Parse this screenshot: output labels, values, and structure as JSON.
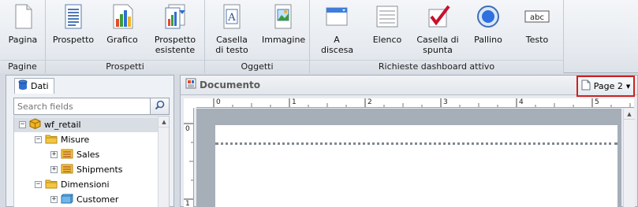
{
  "ribbon": {
    "groups": [
      {
        "label": "Pagine",
        "buttons": [
          {
            "label": "Pagina",
            "icon": "blank-page-icon"
          }
        ]
      },
      {
        "label": "Prospetti",
        "buttons": [
          {
            "label": "Prospetto",
            "icon": "report-page-icon"
          },
          {
            "label": "Grafico",
            "icon": "chart-page-icon"
          },
          {
            "label": "Prospetto\nesistente",
            "icon": "existing-report-icon"
          }
        ]
      },
      {
        "label": "Oggetti",
        "buttons": [
          {
            "label": "Casella\ndi testo",
            "icon": "text-box-icon"
          },
          {
            "label": "Immagine",
            "icon": "image-icon"
          }
        ]
      },
      {
        "label": "Richieste dashboard attivo",
        "buttons": [
          {
            "label": "A\ndiscesa",
            "icon": "dropdown-icon"
          },
          {
            "label": "Elenco",
            "icon": "list-icon"
          },
          {
            "label": "Casella di\nspunta",
            "icon": "checkbox-icon"
          },
          {
            "label": "Pallino",
            "icon": "radio-button-icon"
          },
          {
            "label": "Testo",
            "icon": "text-field-icon"
          }
        ]
      }
    ]
  },
  "left_panel": {
    "tab_label": "Dati",
    "search_placeholder": "Search fields",
    "tree": [
      {
        "label": "wf_retail",
        "icon": "cube-icon",
        "expander": "−",
        "level": 0,
        "selected": true
      },
      {
        "label": "Misure",
        "icon": "folder-icon",
        "expander": "−",
        "level": 1
      },
      {
        "label": "Sales",
        "icon": "measure-icon",
        "expander": "+",
        "level": 2
      },
      {
        "label": "Shipments",
        "icon": "measure-icon",
        "expander": "+",
        "level": 2
      },
      {
        "label": "Dimensioni",
        "icon": "folder-icon",
        "expander": "−",
        "level": 1
      },
      {
        "label": "Customer",
        "icon": "dimension-icon",
        "expander": "+",
        "level": 2
      }
    ]
  },
  "document": {
    "title": "Documento",
    "page_button_label": "Page 2",
    "ruler_top_numbers": [
      "0",
      "1",
      "2",
      "3",
      "4",
      "5"
    ],
    "ruler_left_numbers": [
      "0",
      "1"
    ]
  },
  "colors": {
    "highlight_border": "#cc2222",
    "selected_row": "#d9dee5",
    "canvas_gray": "#a6aeb8"
  }
}
